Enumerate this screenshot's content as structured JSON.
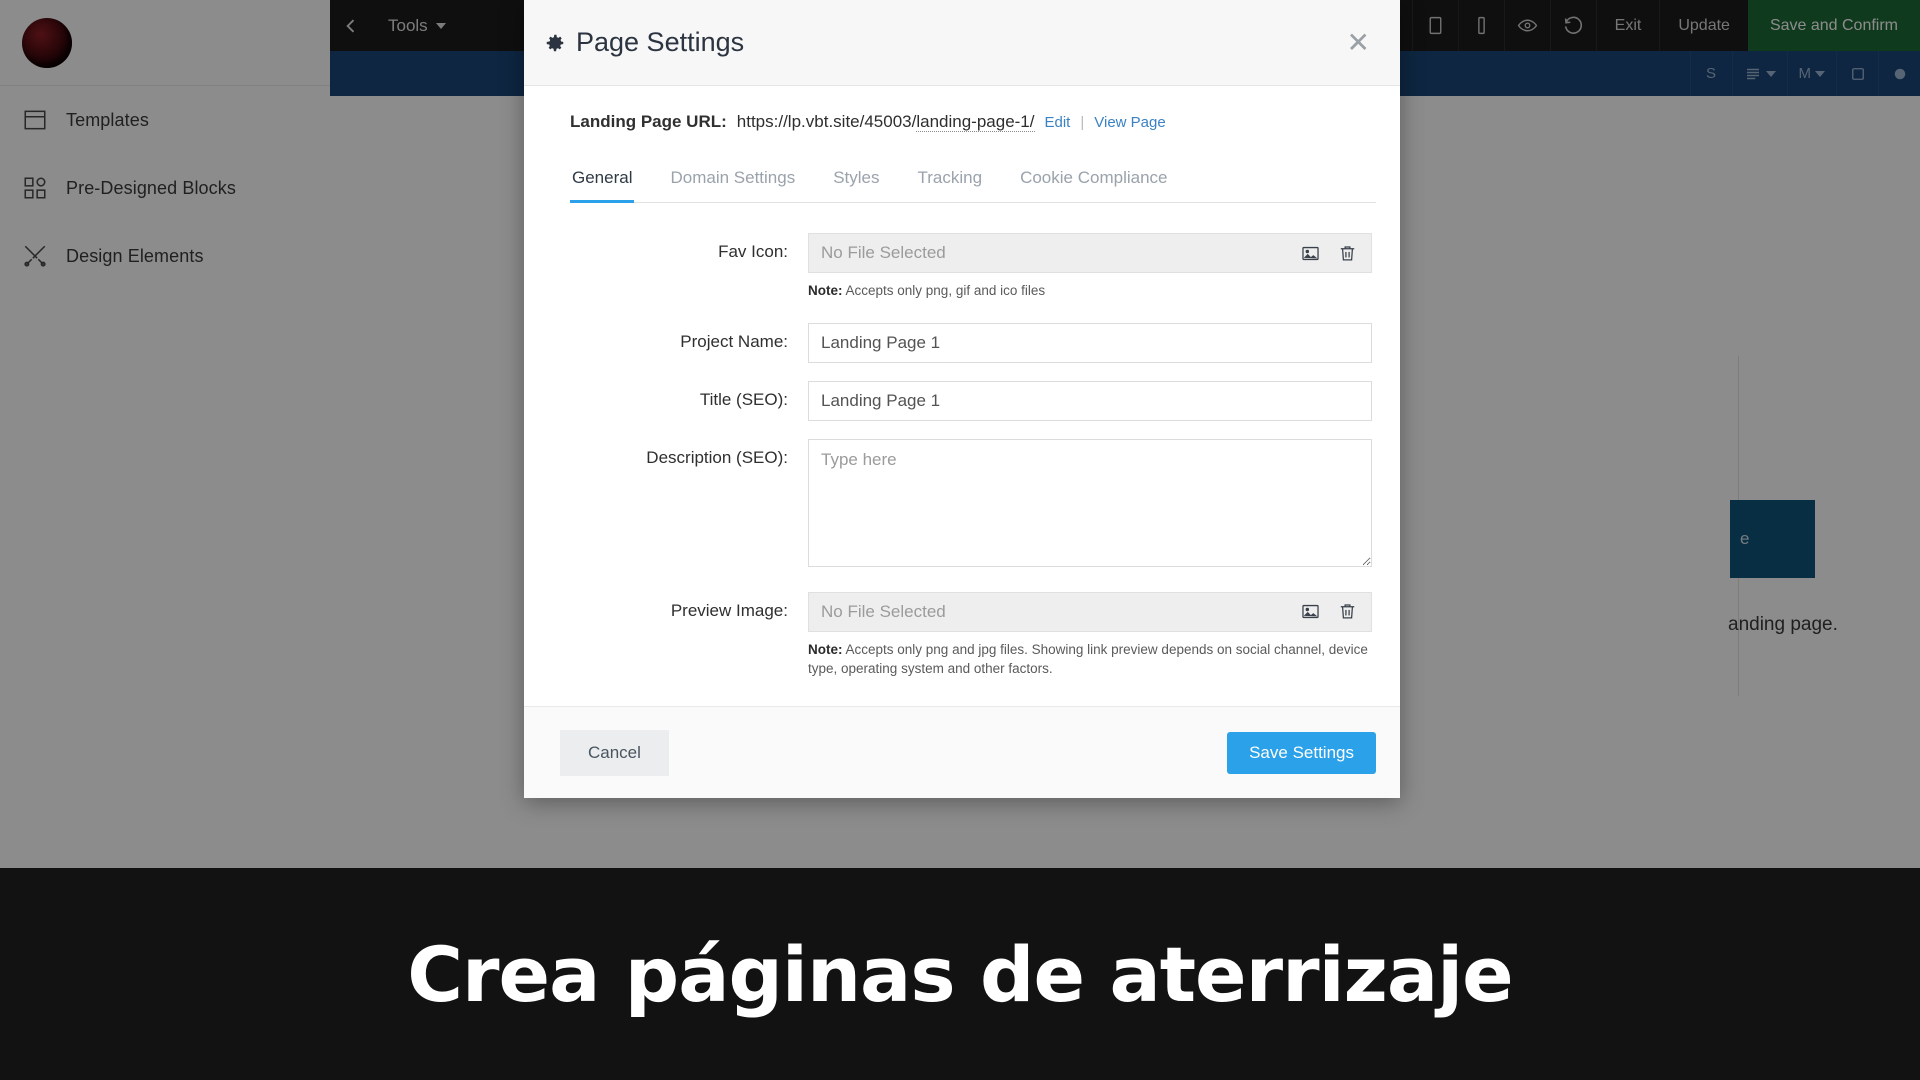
{
  "sidebar": {
    "logo_name": "app-logo",
    "items": [
      {
        "label": "Templates",
        "icon": "templates-icon"
      },
      {
        "label": "Pre-Designed Blocks",
        "icon": "blocks-icon"
      },
      {
        "label": "Design Elements",
        "icon": "design-elements-icon"
      }
    ]
  },
  "topbar": {
    "back_icon": "chevron-left-icon",
    "tools_label": "Tools",
    "device_icons": [
      "desktop-icon",
      "tablet-icon",
      "mobile-icon"
    ],
    "preview_icon": "eye-icon",
    "history_icon": "history-icon",
    "exit_label": "Exit",
    "update_label": "Update",
    "save_confirm_label": "Save and Confirm",
    "confirm_color": "#1c6b36"
  },
  "subbar": {
    "items": [
      {
        "name": "strikethrough-icon",
        "glyph": "S"
      },
      {
        "name": "align-icon",
        "glyph": ""
      },
      {
        "name": "heading-icon",
        "glyph": "M"
      },
      {
        "name": "border-icon",
        "glyph": ""
      },
      {
        "name": "color-icon",
        "glyph": ""
      }
    ]
  },
  "canvas": {
    "hero_button_fragment": "e",
    "hero_subtext_fragment": "anding page.",
    "hero_button_color": "#10557a"
  },
  "modal": {
    "title": "Page Settings",
    "gear_icon": "gear-icon",
    "close_icon": "close-icon",
    "url_label": "Landing Page URL:",
    "url_base": "https://lp.vbt.site/45003/",
    "url_slug": "landing-page-1/",
    "edit_label": "Edit",
    "separator": "|",
    "view_page_label": "View Page",
    "tabs": [
      {
        "label": "General",
        "active": true
      },
      {
        "label": "Domain Settings",
        "active": false
      },
      {
        "label": "Styles",
        "active": false
      },
      {
        "label": "Tracking",
        "active": false
      },
      {
        "label": "Cookie Compliance",
        "active": false
      }
    ],
    "active_tab_color": "#2aa1e8",
    "fields": {
      "fav_icon": {
        "label": "Fav Icon:",
        "placeholder": "No File Selected",
        "note_prefix": "Note:",
        "note_text": " Accepts only png, gif and ico files",
        "browse_icon": "image-icon",
        "delete_icon": "trash-icon"
      },
      "project_name": {
        "label": "Project Name:",
        "value": "Landing Page 1"
      },
      "title_seo": {
        "label": "Title (SEO):",
        "value": "Landing Page 1"
      },
      "description_seo": {
        "label": "Description (SEO):",
        "value": "",
        "placeholder": "Type here"
      },
      "preview_image": {
        "label": "Preview Image:",
        "placeholder": "No File Selected",
        "note_prefix": "Note:",
        "note_text": " Accepts only png and jpg files. Showing link preview depends on social channel, device type, operating system and other factors.",
        "browse_icon": "image-icon",
        "delete_icon": "trash-icon"
      }
    },
    "cancel_label": "Cancel",
    "save_label": "Save Settings",
    "save_color": "#2aa1e8"
  },
  "caption": {
    "text": "Crea páginas de aterrizaje"
  }
}
